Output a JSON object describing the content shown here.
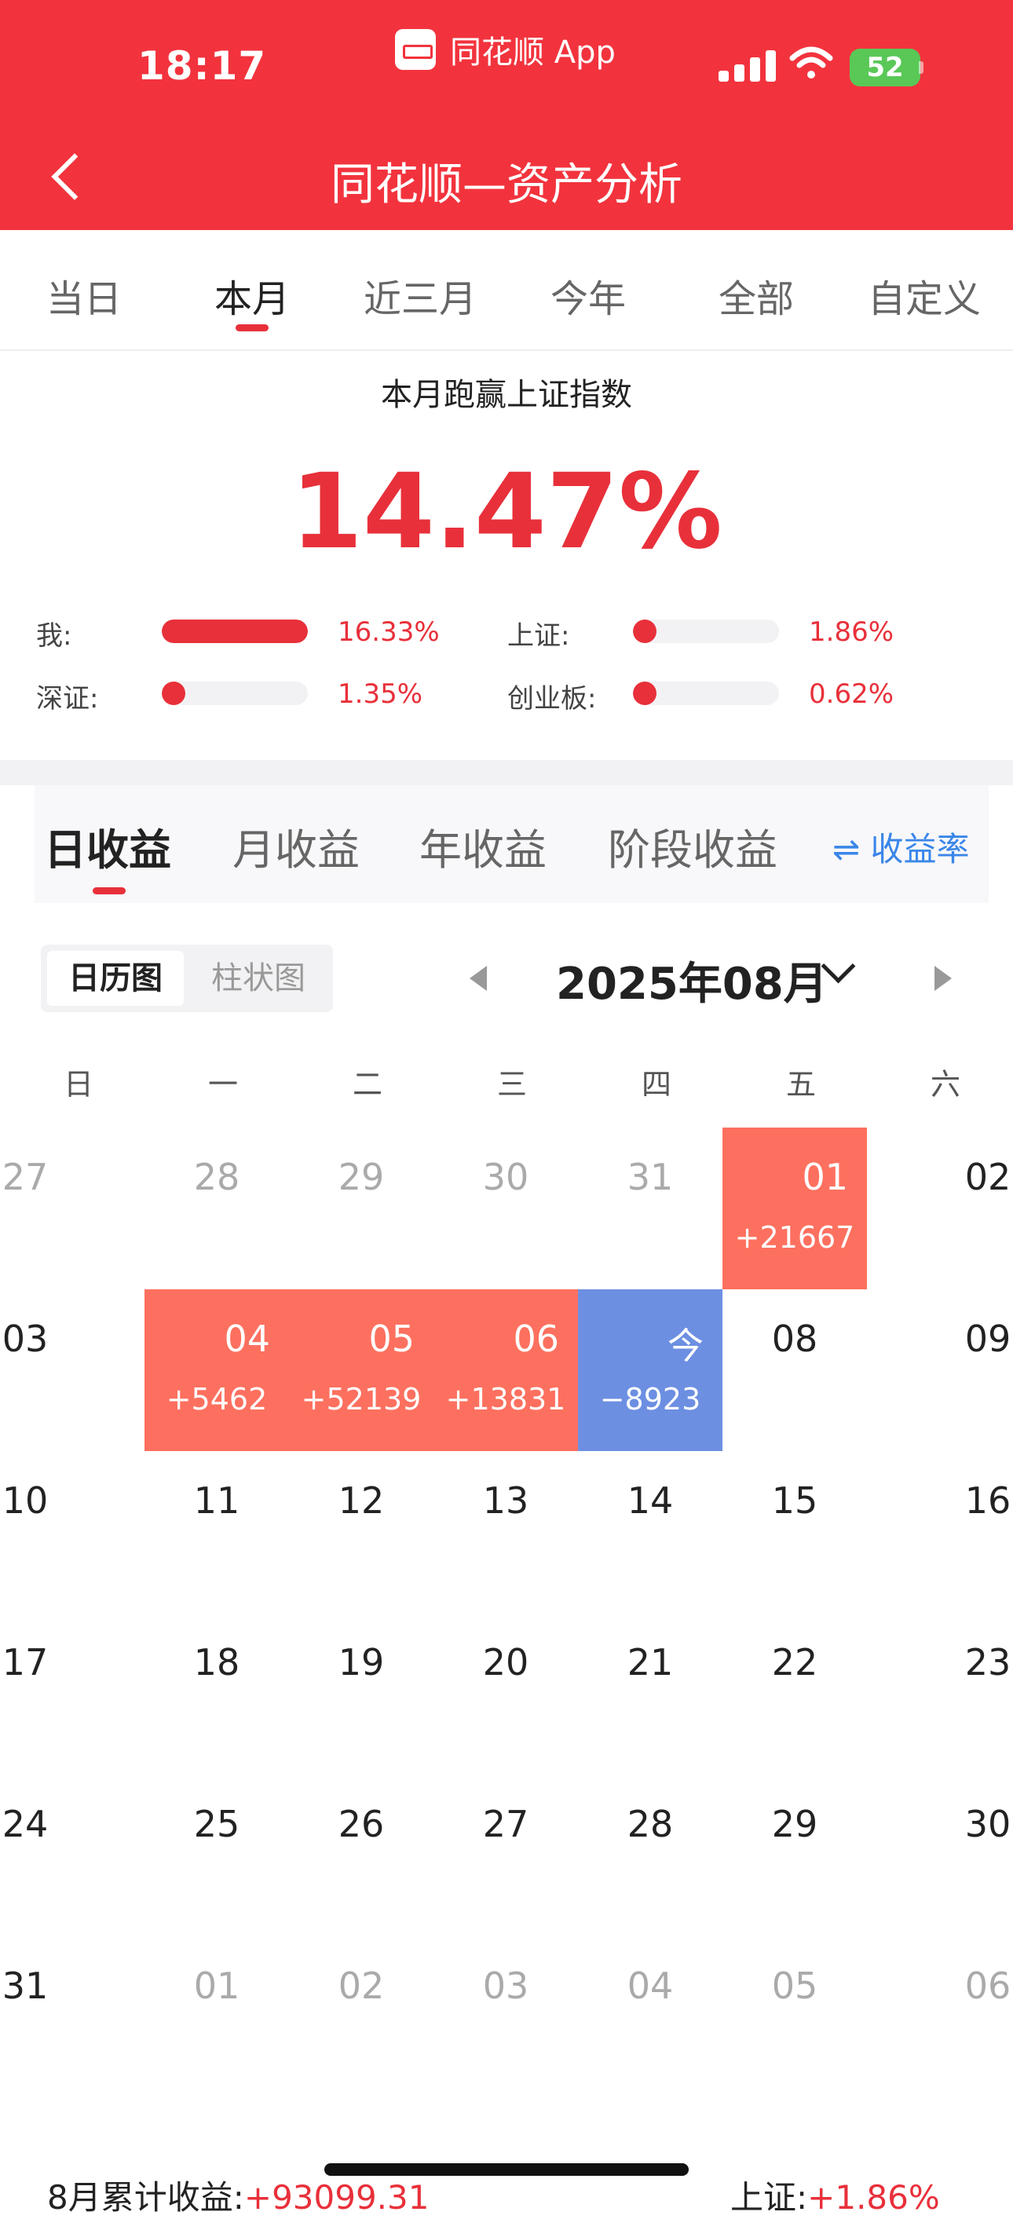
{
  "status_bar": {
    "time": "18:17",
    "app_name": "同花顺 App",
    "battery": "52"
  },
  "nav": {
    "title": "同花顺—资产分析"
  },
  "period_tabs": [
    {
      "label": "当日"
    },
    {
      "label": "本月"
    },
    {
      "label": "近三月"
    },
    {
      "label": "今年"
    },
    {
      "label": "全部"
    },
    {
      "label": "自定义"
    }
  ],
  "active_period": "本月",
  "summary": {
    "title": "本月跑赢上证指数",
    "outperform_pct": "14.47%",
    "bars": [
      {
        "label": "我:",
        "value": "16.33%",
        "fraction": 1.0
      },
      {
        "label": "上证:",
        "value": "1.86%",
        "fraction": 0.114
      },
      {
        "label": "深证:",
        "value": "1.35%",
        "fraction": 0.083
      },
      {
        "label": "创业板:",
        "value": "0.62%",
        "fraction": 0.038
      }
    ]
  },
  "income_tabs": [
    {
      "label": "日收益"
    },
    {
      "label": "月收益"
    },
    {
      "label": "年收益"
    },
    {
      "label": "阶段收益"
    }
  ],
  "rate_switch": "⇌ 收益率",
  "view_toggle": {
    "calendar": "日历图",
    "bar": "柱状图"
  },
  "month_label": "2025年08月",
  "weekdays": [
    "日",
    "一",
    "二",
    "三",
    "四",
    "五",
    "六"
  ],
  "calendar": [
    [
      {
        "day": "27",
        "muted": true
      },
      {
        "day": "28",
        "muted": true
      },
      {
        "day": "29",
        "muted": true
      },
      {
        "day": "30",
        "muted": true
      },
      {
        "day": "31",
        "muted": true
      },
      {
        "day": "01",
        "amount": "+21667",
        "type": "gain"
      },
      {
        "day": "02"
      }
    ],
    [
      {
        "day": "03"
      },
      {
        "day": "04",
        "amount": "+5462",
        "type": "gain"
      },
      {
        "day": "05",
        "amount": "+52139",
        "type": "gain"
      },
      {
        "day": "06",
        "amount": "+13831",
        "type": "gain"
      },
      {
        "day": "今",
        "amount": "−8923",
        "type": "loss"
      },
      {
        "day": "08"
      },
      {
        "day": "09"
      }
    ],
    [
      {
        "day": "10"
      },
      {
        "day": "11"
      },
      {
        "day": "12"
      },
      {
        "day": "13"
      },
      {
        "day": "14"
      },
      {
        "day": "15"
      },
      {
        "day": "16"
      }
    ],
    [
      {
        "day": "17"
      },
      {
        "day": "18"
      },
      {
        "day": "19"
      },
      {
        "day": "20"
      },
      {
        "day": "21"
      },
      {
        "day": "22"
      },
      {
        "day": "23"
      }
    ],
    [
      {
        "day": "24"
      },
      {
        "day": "25"
      },
      {
        "day": "26"
      },
      {
        "day": "27"
      },
      {
        "day": "28"
      },
      {
        "day": "29"
      },
      {
        "day": "30"
      }
    ],
    [
      {
        "day": "31"
      },
      {
        "day": "01",
        "muted": true
      },
      {
        "day": "02",
        "muted": true
      },
      {
        "day": "03",
        "muted": true
      },
      {
        "day": "04",
        "muted": true
      },
      {
        "day": "05",
        "muted": true
      },
      {
        "day": "06",
        "muted": true
      }
    ]
  ],
  "footer": {
    "cum_label": "8月累计收益:",
    "cum_value": "+93099.31",
    "index_label": "上证:",
    "index_value": "+1.86%"
  },
  "colors": {
    "brand_red": "#f2333d",
    "gain": "#fd705f",
    "loss": "#6d8fe2",
    "link_blue": "#3a86e8"
  }
}
